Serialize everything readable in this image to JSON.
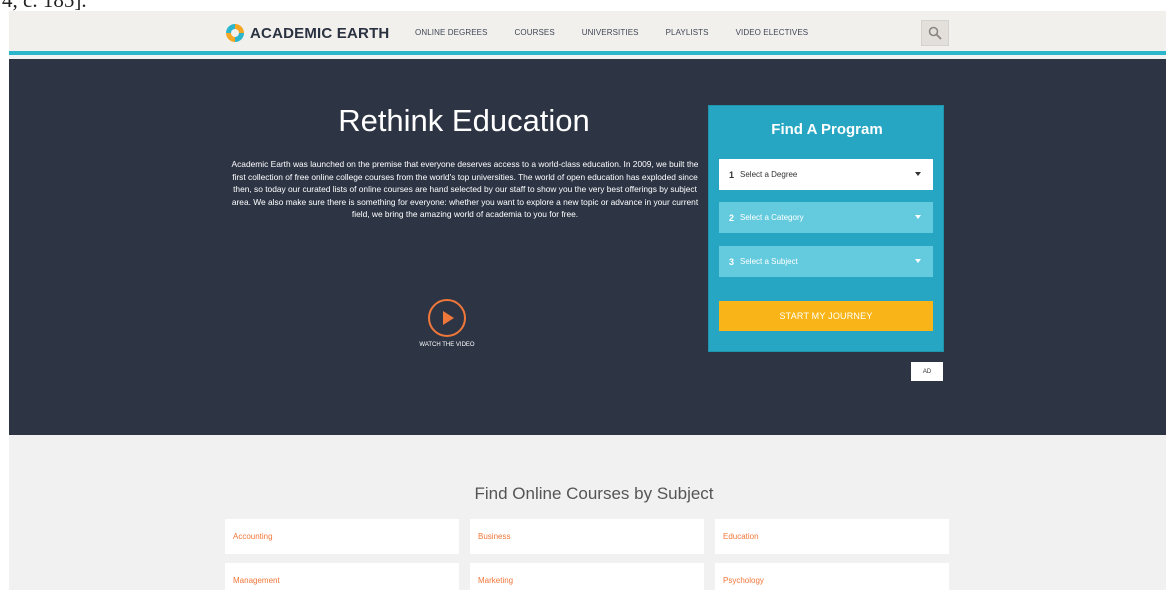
{
  "caption_fragment": "4, c. 185].",
  "brand": {
    "name": "ACADEMIC EARTH",
    "accent": "#2bb6cc",
    "orange": "#f0773a",
    "yellow": "#f9b517",
    "hero_bg": "#2d3545"
  },
  "nav": {
    "items": [
      "ONLINE DEGREES",
      "COURSES",
      "UNIVERSITIES",
      "PLAYLISTS",
      "VIDEO ELECTIVES"
    ],
    "search_icon": "search-icon"
  },
  "hero": {
    "title": "Rethink Education",
    "text": "Academic Earth was launched on the premise that everyone deserves access to a world-class education. In 2009, we built the first collection of free online college courses from the world's top universities. The world of open education has exploded since then, so today our curated lists of online courses are hand selected by our staff to show you the very best offerings by subject area. We also make sure there is something for everyone: whether you want to explore a new topic or advance in your current field, we bring the amazing world of academia to you for free.",
    "video_label": "WATCH THE VIDEO"
  },
  "program": {
    "title": "Find A Program",
    "selects": [
      {
        "num": "1",
        "placeholder": "Select a Degree"
      },
      {
        "num": "2",
        "placeholder": "Select a Category"
      },
      {
        "num": "3",
        "placeholder": "Select a Subject"
      }
    ],
    "button": "START MY JOURNEY",
    "ad": "AD"
  },
  "subjects": {
    "title": "Find Online Courses by Subject",
    "items": [
      "Accounting",
      "Business",
      "Education",
      "Management",
      "Marketing",
      "Psychology"
    ]
  }
}
